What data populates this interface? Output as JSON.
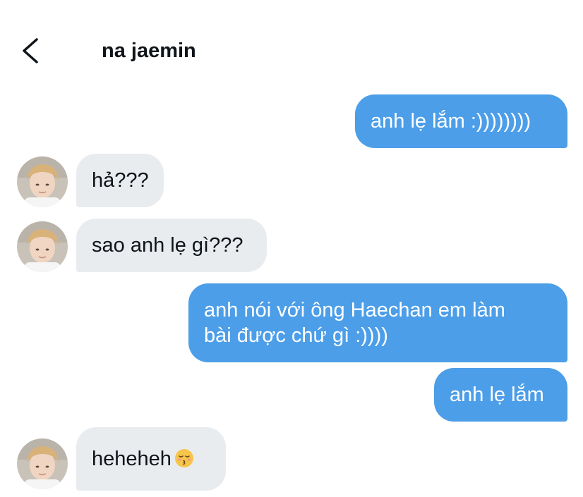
{
  "header": {
    "title": "na jaemin",
    "back_icon": "chevron-left-icon"
  },
  "colors": {
    "outgoing_bubble": "#4c9ee8",
    "incoming_bubble": "#e9ecef",
    "text_dark": "#0f1419"
  },
  "messages": [
    {
      "direction": "outgoing",
      "lines": [
        "anh lẹ lắm :))))))))"
      ]
    },
    {
      "direction": "incoming",
      "lines": [
        "hả???"
      ]
    },
    {
      "direction": "incoming",
      "lines": [
        "sao anh lẹ gì???"
      ]
    },
    {
      "direction": "outgoing",
      "lines": [
        "anh nói với ông Haechan em làm",
        "bài được chứ gì :))))"
      ]
    },
    {
      "direction": "outgoing",
      "lines": [
        "anh lẹ lắm"
      ]
    },
    {
      "direction": "incoming",
      "lines": [
        "heheheh"
      ],
      "emoji": "kissing-face-with-closed-eyes-icon"
    }
  ]
}
